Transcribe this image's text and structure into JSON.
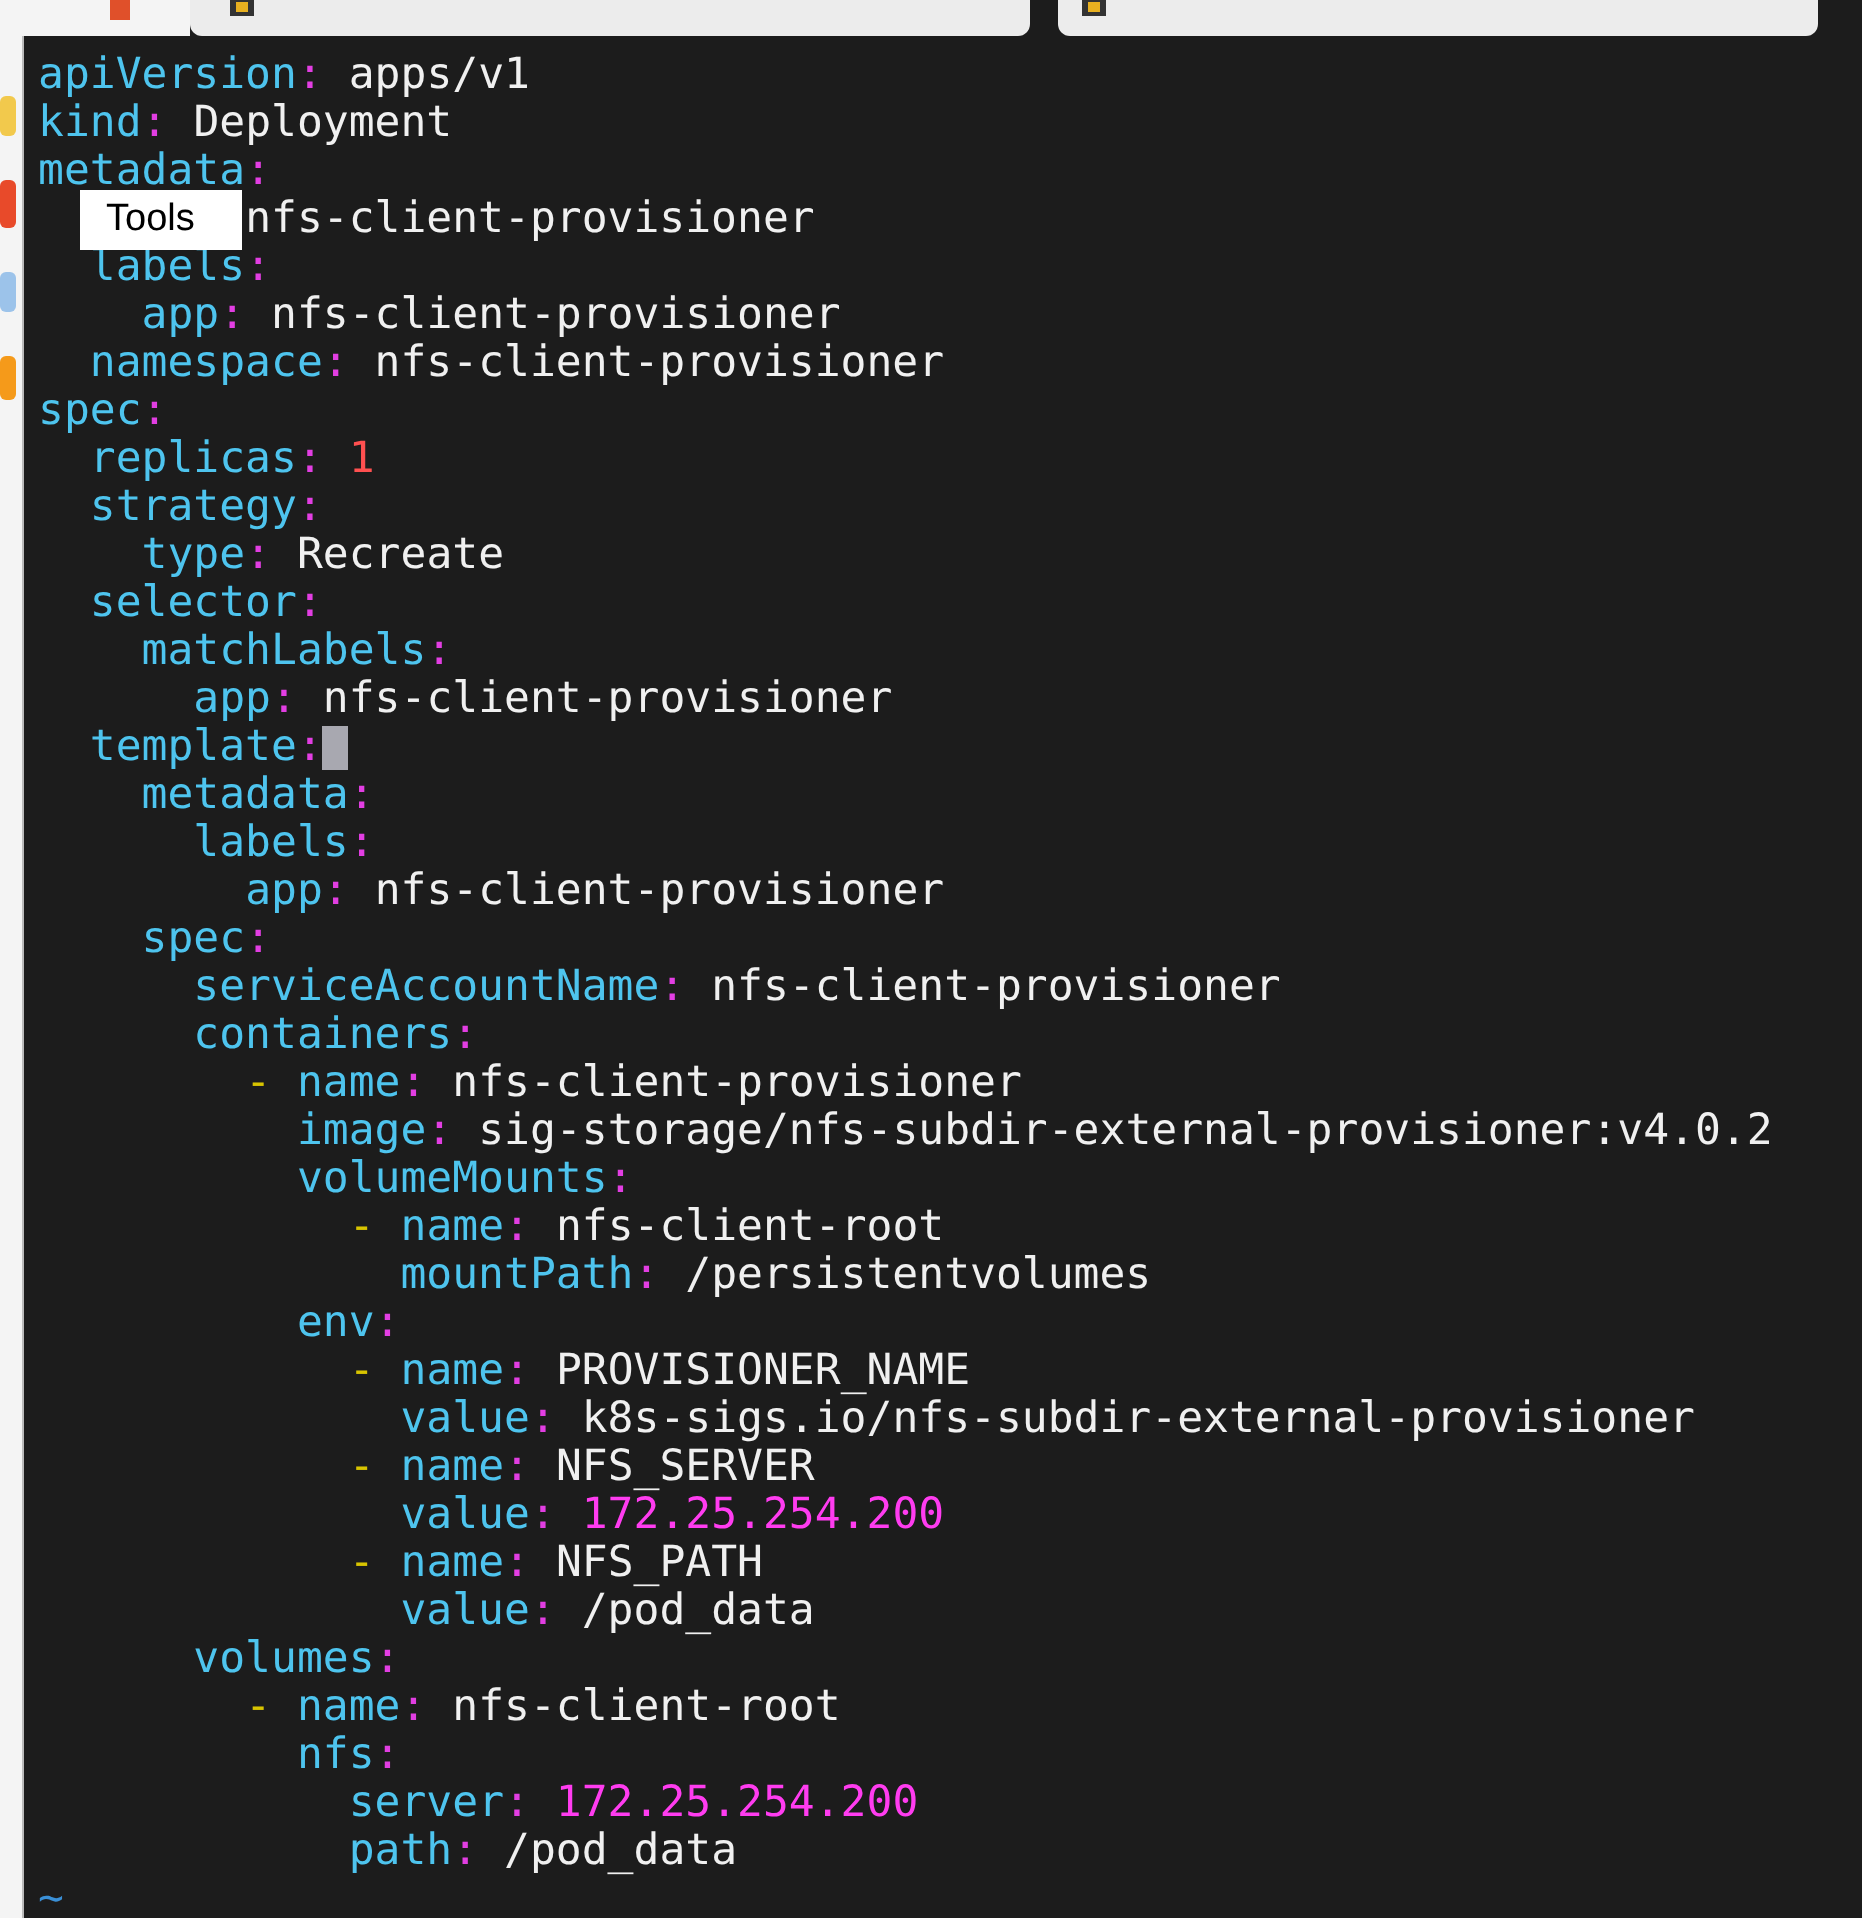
{
  "lines": [
    {
      "tokens": [
        {
          "kind": "key",
          "text": "apiVersion"
        },
        {
          "kind": "colon",
          "text": ":"
        },
        {
          "kind": "value",
          "text": " apps/v1"
        }
      ]
    },
    {
      "tokens": [
        {
          "kind": "key",
          "text": "kind"
        },
        {
          "kind": "colon",
          "text": ":"
        },
        {
          "kind": "value",
          "text": " Deployment"
        }
      ]
    },
    {
      "tokens": [
        {
          "kind": "key",
          "text": "metadata"
        },
        {
          "kind": "colon",
          "text": ":"
        }
      ]
    },
    {
      "tokens": [
        {
          "kind": "value",
          "text": "        nfs-client-provisioner"
        }
      ]
    },
    {
      "tokens": [
        {
          "kind": "key",
          "text": "  labels"
        },
        {
          "kind": "colon",
          "text": ":"
        }
      ]
    },
    {
      "tokens": [
        {
          "kind": "key",
          "text": "    app"
        },
        {
          "kind": "colon",
          "text": ":"
        },
        {
          "kind": "value",
          "text": " nfs-client-provisioner"
        }
      ]
    },
    {
      "tokens": [
        {
          "kind": "key",
          "text": "  namespace"
        },
        {
          "kind": "colon",
          "text": ":"
        },
        {
          "kind": "value",
          "text": " nfs-client-provisioner"
        }
      ]
    },
    {
      "tokens": [
        {
          "kind": "key",
          "text": "spec"
        },
        {
          "kind": "colon",
          "text": ":"
        }
      ]
    },
    {
      "tokens": [
        {
          "kind": "key",
          "text": "  replicas"
        },
        {
          "kind": "colon",
          "text": ":"
        },
        {
          "kind": "number",
          "text": " 1"
        }
      ]
    },
    {
      "tokens": [
        {
          "kind": "key",
          "text": "  strategy"
        },
        {
          "kind": "colon",
          "text": ":"
        }
      ]
    },
    {
      "tokens": [
        {
          "kind": "key",
          "text": "    type"
        },
        {
          "kind": "colon",
          "text": ":"
        },
        {
          "kind": "value",
          "text": " Recreate"
        }
      ]
    },
    {
      "tokens": [
        {
          "kind": "key",
          "text": "  selector"
        },
        {
          "kind": "colon",
          "text": ":"
        }
      ]
    },
    {
      "tokens": [
        {
          "kind": "key",
          "text": "    matchLabels"
        },
        {
          "kind": "colon",
          "text": ":"
        }
      ]
    },
    {
      "tokens": [
        {
          "kind": "key",
          "text": "      app"
        },
        {
          "kind": "colon",
          "text": ":"
        },
        {
          "kind": "value",
          "text": " nfs-client-provisioner"
        }
      ]
    },
    {
      "tokens": [
        {
          "kind": "key",
          "text": "  template"
        },
        {
          "kind": "colon",
          "text": ":"
        }
      ],
      "cursor": true
    },
    {
      "tokens": [
        {
          "kind": "key",
          "text": "    metadata"
        },
        {
          "kind": "colon",
          "text": ":"
        }
      ]
    },
    {
      "tokens": [
        {
          "kind": "key",
          "text": "      labels"
        },
        {
          "kind": "colon",
          "text": ":"
        }
      ]
    },
    {
      "tokens": [
        {
          "kind": "key",
          "text": "        app"
        },
        {
          "kind": "colon",
          "text": ":"
        },
        {
          "kind": "value",
          "text": " nfs-client-provisioner"
        }
      ]
    },
    {
      "tokens": [
        {
          "kind": "key",
          "text": "    spec"
        },
        {
          "kind": "colon",
          "text": ":"
        }
      ]
    },
    {
      "tokens": [
        {
          "kind": "key",
          "text": "      serviceAccountName"
        },
        {
          "kind": "colon",
          "text": ":"
        },
        {
          "kind": "value",
          "text": " nfs-client-provisioner"
        }
      ]
    },
    {
      "tokens": [
        {
          "kind": "key",
          "text": "      containers"
        },
        {
          "kind": "colon",
          "text": ":"
        }
      ]
    },
    {
      "tokens": [
        {
          "kind": "dash",
          "text": "        -"
        },
        {
          "kind": "key",
          "text": " name"
        },
        {
          "kind": "colon",
          "text": ":"
        },
        {
          "kind": "value",
          "text": " nfs-client-provisioner"
        }
      ]
    },
    {
      "tokens": [
        {
          "kind": "key",
          "text": "          image"
        },
        {
          "kind": "colon",
          "text": ":"
        },
        {
          "kind": "value",
          "text": " sig-storage/nfs-subdir-external-provisioner:v4.0.2"
        }
      ]
    },
    {
      "tokens": [
        {
          "kind": "key",
          "text": "          volumeMounts"
        },
        {
          "kind": "colon",
          "text": ":"
        }
      ]
    },
    {
      "tokens": [
        {
          "kind": "dash",
          "text": "            -"
        },
        {
          "kind": "key",
          "text": " name"
        },
        {
          "kind": "colon",
          "text": ":"
        },
        {
          "kind": "value",
          "text": " nfs-client-root"
        }
      ]
    },
    {
      "tokens": [
        {
          "kind": "key",
          "text": "              mountPath"
        },
        {
          "kind": "colon",
          "text": ":"
        },
        {
          "kind": "value",
          "text": " /persistentvolumes"
        }
      ]
    },
    {
      "tokens": [
        {
          "kind": "key",
          "text": "          env"
        },
        {
          "kind": "colon",
          "text": ":"
        }
      ]
    },
    {
      "tokens": [
        {
          "kind": "dash",
          "text": "            -"
        },
        {
          "kind": "key",
          "text": " name"
        },
        {
          "kind": "colon",
          "text": ":"
        },
        {
          "kind": "value",
          "text": " PROVISIONER_NAME"
        }
      ]
    },
    {
      "tokens": [
        {
          "kind": "key",
          "text": "              value"
        },
        {
          "kind": "colon",
          "text": ":"
        },
        {
          "kind": "value",
          "text": " k8s-sigs.io/nfs-subdir-external-provisioner"
        }
      ]
    },
    {
      "tokens": [
        {
          "kind": "dash",
          "text": "            -"
        },
        {
          "kind": "key",
          "text": " name"
        },
        {
          "kind": "colon",
          "text": ":"
        },
        {
          "kind": "value",
          "text": " NFS_SERVER"
        }
      ]
    },
    {
      "tokens": [
        {
          "kind": "key",
          "text": "              value"
        },
        {
          "kind": "colon",
          "text": ":"
        },
        {
          "kind": "ip",
          "text": " 172.25.254.200"
        }
      ]
    },
    {
      "tokens": [
        {
          "kind": "dash",
          "text": "            -"
        },
        {
          "kind": "key",
          "text": " name"
        },
        {
          "kind": "colon",
          "text": ":"
        },
        {
          "kind": "value",
          "text": " NFS_PATH"
        }
      ]
    },
    {
      "tokens": [
        {
          "kind": "key",
          "text": "              value"
        },
        {
          "kind": "colon",
          "text": ":"
        },
        {
          "kind": "value",
          "text": " /pod_data"
        }
      ]
    },
    {
      "tokens": [
        {
          "kind": "key",
          "text": "      volumes"
        },
        {
          "kind": "colon",
          "text": ":"
        }
      ]
    },
    {
      "tokens": [
        {
          "kind": "dash",
          "text": "        -"
        },
        {
          "kind": "key",
          "text": " name"
        },
        {
          "kind": "colon",
          "text": ":"
        },
        {
          "kind": "value",
          "text": " nfs-client-root"
        }
      ]
    },
    {
      "tokens": [
        {
          "kind": "key",
          "text": "          nfs"
        },
        {
          "kind": "colon",
          "text": ":"
        }
      ]
    },
    {
      "tokens": [
        {
          "kind": "key",
          "text": "            server"
        },
        {
          "kind": "colon",
          "text": ":"
        },
        {
          "kind": "ip",
          "text": " 172.25.254.200"
        }
      ]
    },
    {
      "tokens": [
        {
          "kind": "key",
          "text": "            path"
        },
        {
          "kind": "colon",
          "text": ":"
        },
        {
          "kind": "value",
          "text": " /pod_data"
        }
      ]
    },
    {
      "tokens": [
        {
          "kind": "tilde",
          "text": "~"
        }
      ]
    }
  ],
  "tooltip": {
    "text": "Tools"
  }
}
